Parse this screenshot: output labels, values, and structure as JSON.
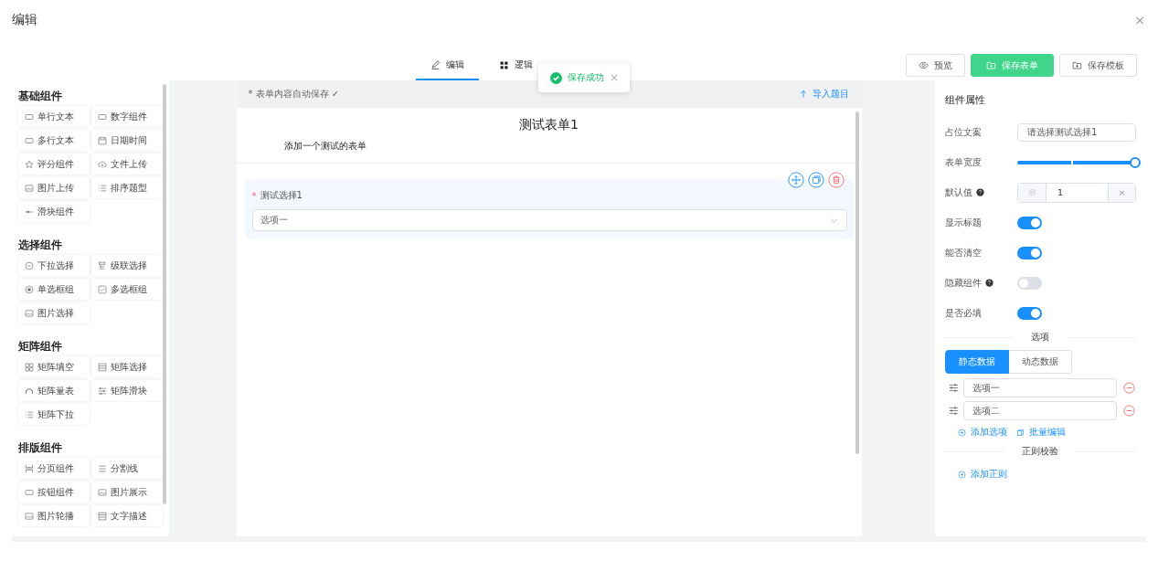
{
  "dialog": {
    "title": "编辑",
    "close": "×"
  },
  "tabs": [
    {
      "label": "编辑",
      "selected": true
    },
    {
      "label": "逻辑",
      "selected": false
    }
  ],
  "toast": {
    "text": "保存成功",
    "close": "×"
  },
  "actions": [
    {
      "label": "预览",
      "primary": false
    },
    {
      "label": "保存表单",
      "primary": true
    },
    {
      "label": "保存模板",
      "primary": false
    }
  ],
  "palette": [
    {
      "title": "基础组件",
      "items": [
        "单行文本",
        "数字组件",
        "多行文本",
        "日期时间",
        "评分组件",
        "文件上传",
        "图片上传",
        "排序题型",
        "滑块组件"
      ]
    },
    {
      "title": "选择组件",
      "items": [
        "下拉选择",
        "级联选择",
        "单选框组",
        "多选框组",
        "图片选择"
      ]
    },
    {
      "title": "矩阵组件",
      "items": [
        "矩阵填空",
        "矩阵选择",
        "矩阵量表",
        "矩阵滑块",
        "矩阵下拉"
      ]
    },
    {
      "title": "排版组件",
      "items": [
        "分页组件",
        "分割线",
        "按钮组件",
        "图片展示",
        "图片轮播",
        "文字描述"
      ]
    }
  ],
  "form": {
    "autosave": "* 表单内容自动保存 ✓",
    "import": "导入题目",
    "title": "测试表单1",
    "description": "添加一个测试的表单",
    "field": {
      "required_mark": "*",
      "label": "测试选择1",
      "value": "选项一"
    }
  },
  "props": {
    "title": "组件属性",
    "placeholder_label": "占位文案",
    "placeholder_input": {
      "placeholder": "请选择测试选择1"
    },
    "width_label": "表单宽度",
    "width": {
      "level": 1
    },
    "default_label": "默认值",
    "default_value": "1",
    "default_clear": "×",
    "switches": [
      {
        "label": "显示标题",
        "help": false,
        "on": true
      },
      {
        "label": "能否清空",
        "help": false,
        "on": true
      },
      {
        "label": "隐藏组件",
        "help": true,
        "on": false
      },
      {
        "label": "是否必填",
        "help": false,
        "on": true
      }
    ],
    "options_heading": "选项",
    "sources": [
      {
        "label": "静态数据",
        "selected": true
      },
      {
        "label": "动态数据",
        "selected": false
      }
    ],
    "options": [
      "选项一",
      "选项二"
    ],
    "add_option": "添加选项",
    "batch_edit": "批量编辑",
    "rules_heading": "正则校验",
    "add_rule": "添加正则"
  }
}
